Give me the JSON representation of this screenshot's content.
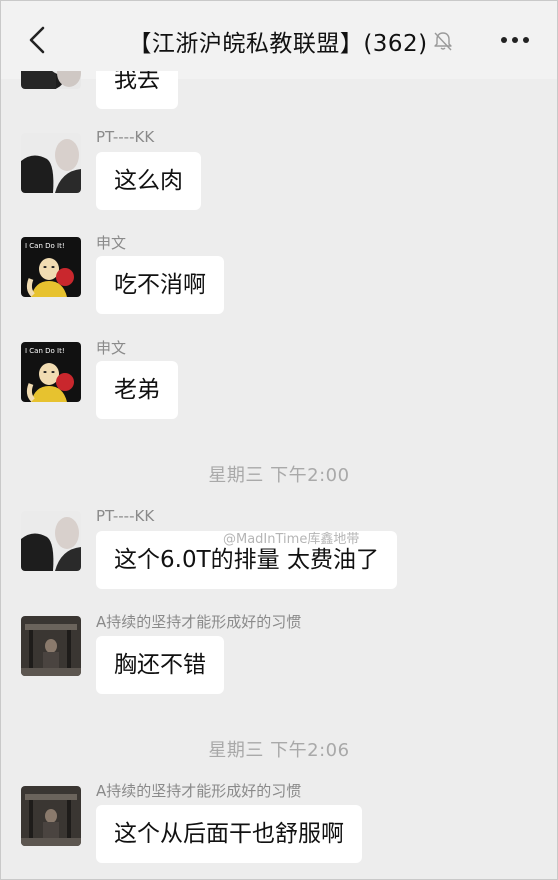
{
  "header": {
    "title": "【江浙沪皖私教联盟】(362)"
  },
  "messages": [
    {
      "sender": "",
      "text": "我去"
    },
    {
      "sender": "PT----KK",
      "text": "这么肉"
    },
    {
      "sender": "申文",
      "text": "吃不消啊"
    },
    {
      "sender": "申文",
      "text": "老弟"
    },
    {
      "sender": "PT----KK",
      "text": "这个6.0T的排量 太费油了"
    },
    {
      "sender": "A持续的坚持才能形成好的习惯",
      "text": "胸还不错"
    },
    {
      "sender": "A持续的坚持才能形成好的习惯",
      "text": "这个从后面干也舒服啊"
    }
  ],
  "timestamps": [
    "星期三 下午2:00",
    "星期三 下午2:06"
  ],
  "avatar_labels": {
    "shenwen": "I Can Do It!"
  },
  "watermark": "@MadInTime库鑫地带",
  "colors": {
    "background": "#ededed",
    "header": "#f2f2f2",
    "bubble": "#ffffff",
    "meta_text": "#8a8a8a"
  }
}
